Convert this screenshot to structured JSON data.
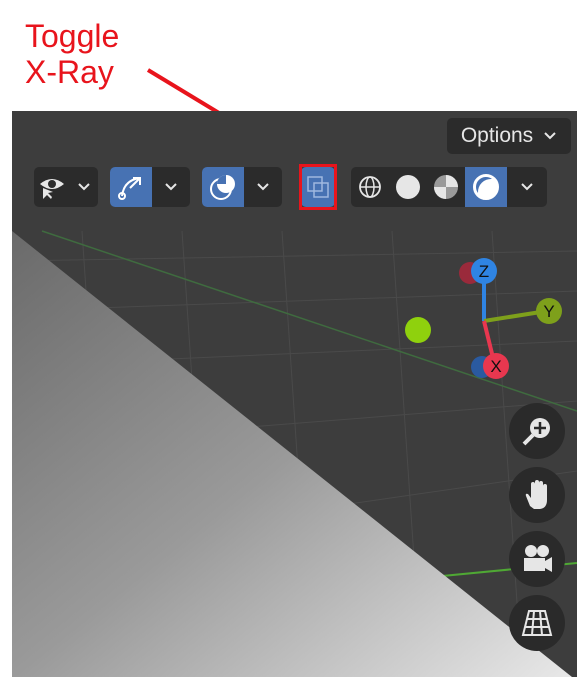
{
  "annotation": {
    "line1": "Toggle",
    "line2": "X-Ray",
    "color": "#e8141c"
  },
  "header": {
    "options_label": "Options"
  },
  "toolbar": {
    "groups": [
      {
        "name": "selectability-visibility",
        "icon": "eye-icon"
      },
      {
        "name": "gizmo",
        "icon": "gizmo-icon",
        "active": true
      },
      {
        "name": "overlays",
        "icon": "overlays-icon",
        "active": true
      },
      {
        "name": "xray",
        "icon": "xray-icon",
        "active": true
      },
      {
        "name": "shading",
        "modes": [
          "wireframe",
          "solid",
          "material-preview",
          "rendered"
        ],
        "active_mode": "rendered"
      }
    ]
  },
  "gizmo_axes": {
    "z": "Z",
    "y": "Y",
    "x": "X"
  },
  "colors": {
    "accent": "#4772b3",
    "viewport_bg": "#3d3d3d",
    "header_bg": "#2b2b2b",
    "x_axis": "#e8374f",
    "y_axis": "#7ea01b",
    "z_axis": "#2f84e3",
    "highlight": "#e8141c"
  }
}
